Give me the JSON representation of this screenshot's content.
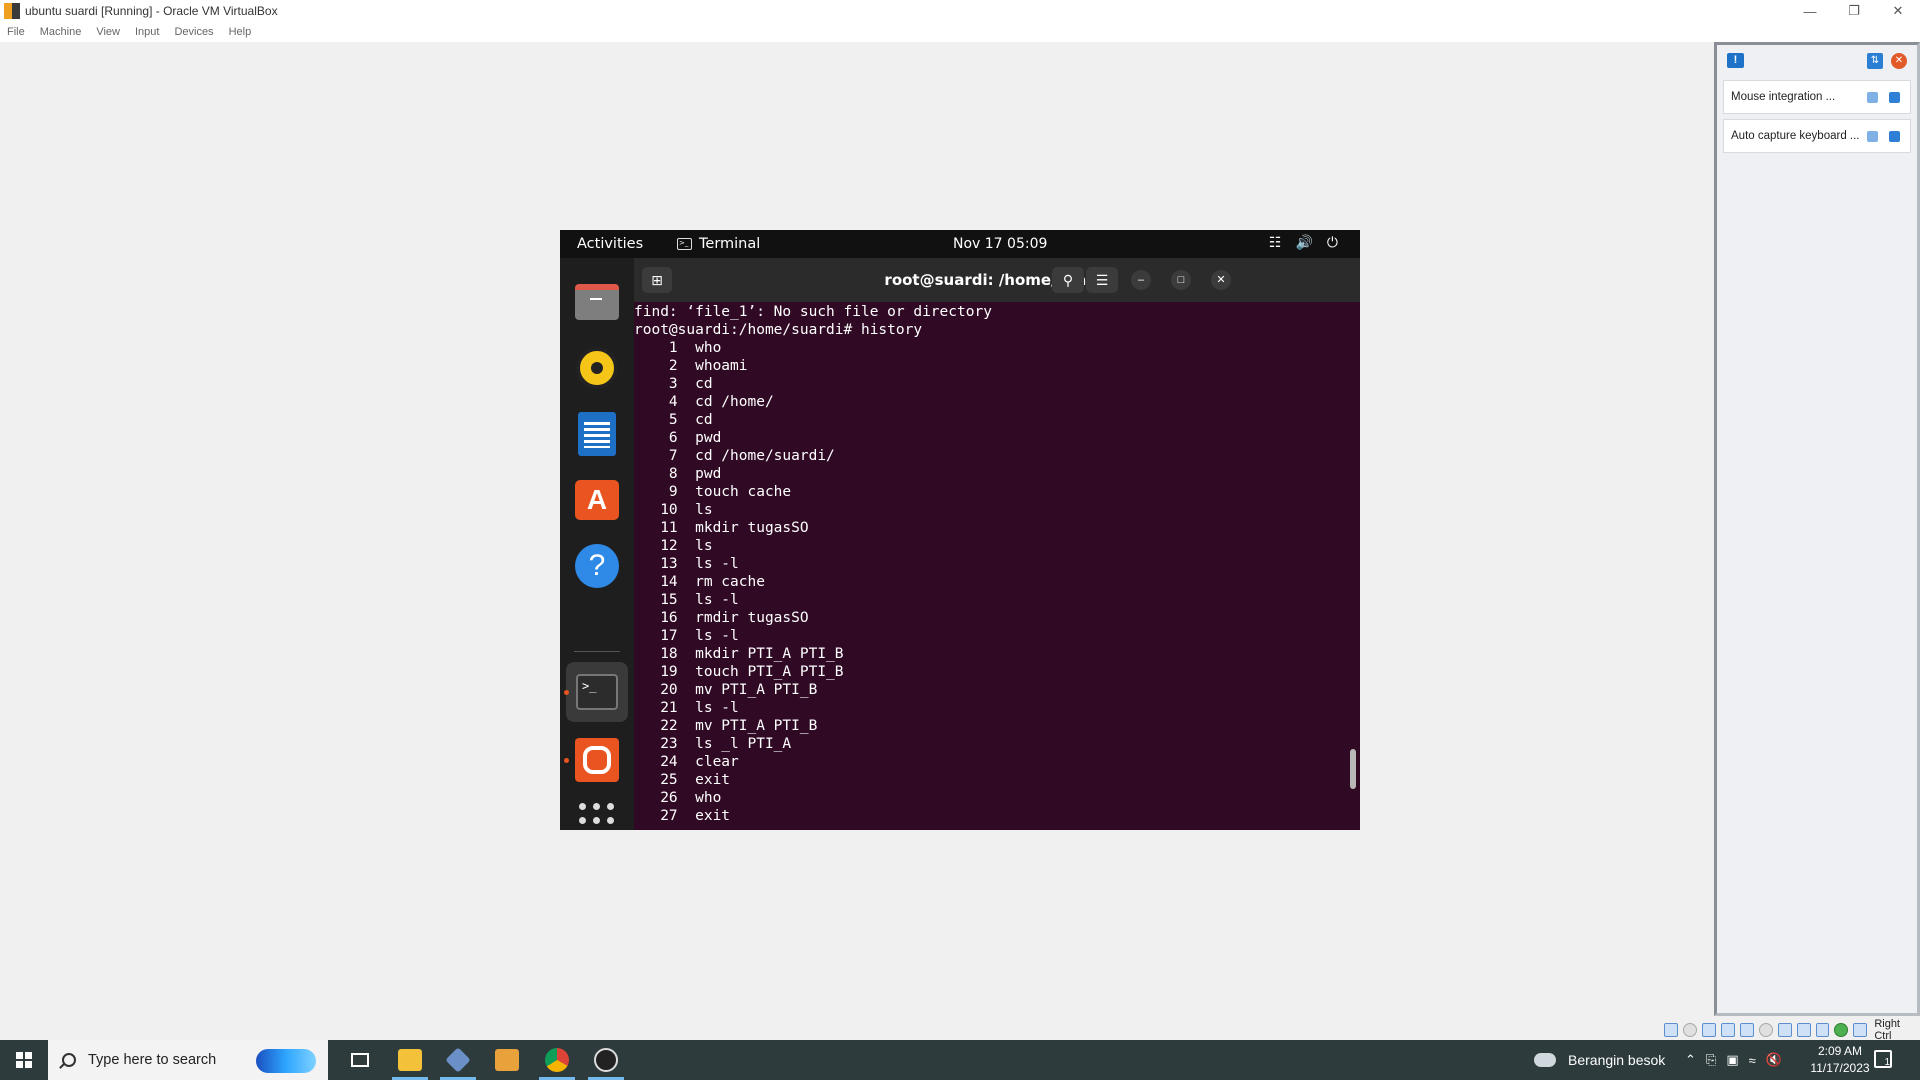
{
  "window": {
    "title": "ubuntu suardi [Running] - Oracle VM VirtualBox",
    "controls": [
      "—",
      "❐",
      "✕"
    ]
  },
  "menu": [
    "File",
    "Machine",
    "View",
    "Input",
    "Devices",
    "Help"
  ],
  "notifications": {
    "items": [
      {
        "text": "Mouse integration ..."
      },
      {
        "text": "Auto capture keyboard ..."
      }
    ]
  },
  "statusbar": {
    "host_key": "Right Ctrl"
  },
  "guest": {
    "topbar": {
      "activities": "Activities",
      "app": "Terminal",
      "clock": "Nov 17  05:09"
    },
    "terminal": {
      "title": "root@suardi: /home/suardi",
      "lines": [
        "find: ‘file_1’: No such file or directory",
        "root@suardi:/home/suardi# history",
        "    1  who",
        "    2  whoami",
        "    3  cd",
        "    4  cd /home/",
        "    5  cd",
        "    6  pwd",
        "    7  cd /home/suardi/",
        "    8  pwd",
        "    9  touch cache",
        "   10  ls",
        "   11  mkdir tugasSO",
        "   12  ls",
        "   13  ls -l",
        "   14  rm cache",
        "   15  ls -l",
        "   16  rmdir tugasSO",
        "   17  ls -l",
        "   18  mkdir PTI_A PTI_B",
        "   19  touch PTI_A PTI_B",
        "   20  mv PTI_A PTI_B",
        "   21  ls -l",
        "   22  mv PTI_A PTI_B",
        "   23  ls _l PTI_A",
        "   24  clear",
        "   25  exit",
        "   26  who",
        "   27  exit"
      ]
    }
  },
  "taskbar": {
    "search_placeholder": "Type here to search",
    "weather": "Berangin besok",
    "time": "2:09 AM",
    "date": "11/17/2023",
    "notification_count": "1"
  }
}
